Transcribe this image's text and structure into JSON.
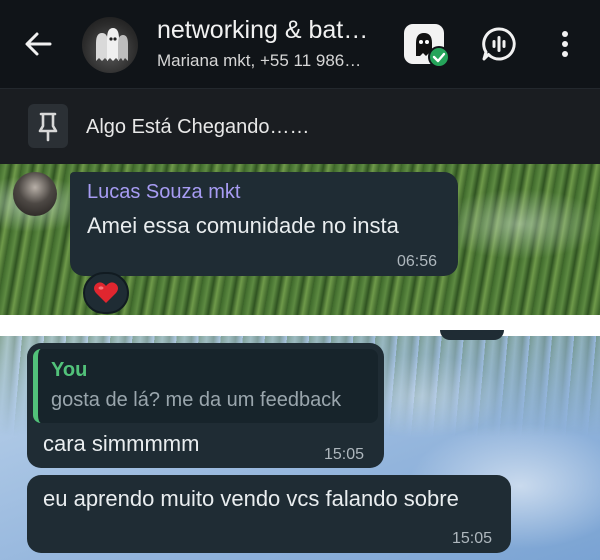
{
  "header": {
    "title": "networking & bat…",
    "subtitle": "Mariana mkt, +55 11 986…",
    "icons": [
      "back-arrow-icon",
      "group-avatar",
      "app-badge-icon",
      "voice-chat-icon",
      "more-vertical-icon"
    ]
  },
  "pinned": {
    "icon": "pin-icon",
    "text": "Algo Está Chegando……"
  },
  "messages": [
    {
      "direction": "incoming",
      "sender": "Lucas Souza mkt",
      "text": "Amei essa comunidade no insta",
      "time": "06:56",
      "reaction": "❤️"
    },
    {
      "direction": "outgoing",
      "quote_author": "You",
      "quote_text": "gosta de lá? me da um feedback",
      "text": "cara simmmmm",
      "time": "15:05"
    },
    {
      "direction": "outgoing",
      "text": "eu aprendo muito vendo vcs falando sobre",
      "time": "15:05"
    }
  ],
  "colors": {
    "header_bg": "#101418",
    "bubble_bg": "#1f2c34",
    "sender_name": "#a79cf3",
    "quote_accent": "#52c27a",
    "badge_green": "#25a45a"
  }
}
